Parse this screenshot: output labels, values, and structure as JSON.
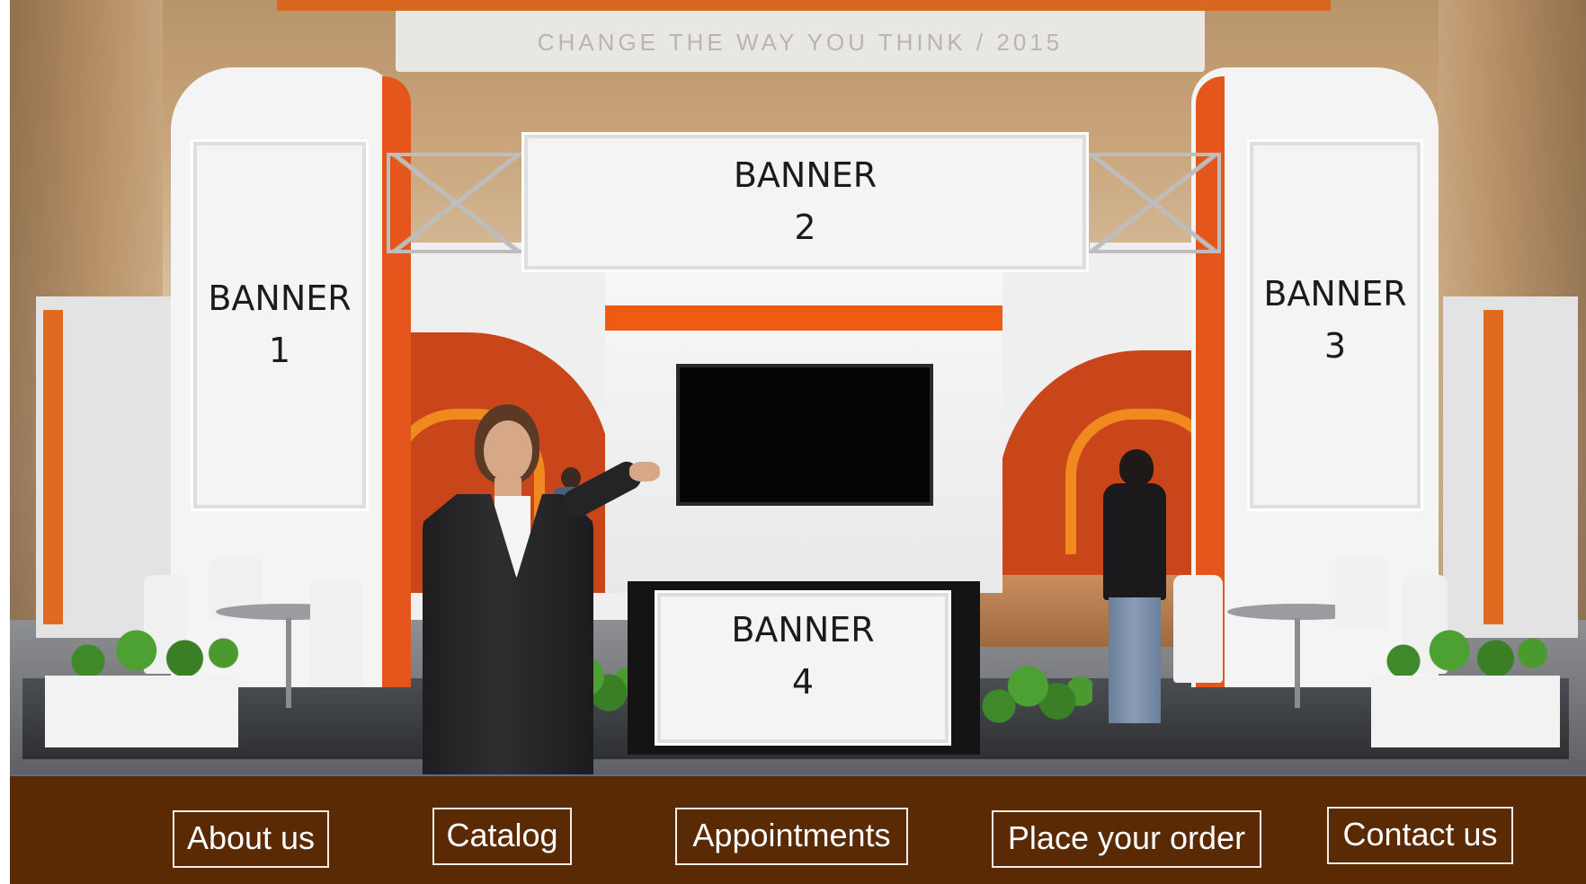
{
  "hall": {
    "sign_text": "CHANGE THE WAY YOU THINK / 2015"
  },
  "banners": [
    {
      "label": "BANNER\n1"
    },
    {
      "label": "BANNER\n2"
    },
    {
      "label": "BANNER\n3"
    },
    {
      "label": "BANNER\n4"
    }
  ],
  "nav": {
    "items": [
      {
        "label": "About us"
      },
      {
        "label": "Catalog"
      },
      {
        "label": "Appointments"
      },
      {
        "label": "Place your order"
      },
      {
        "label": "Contact us"
      }
    ]
  },
  "colors": {
    "nav_background": "#5a2a05",
    "accent_orange": "#e4561b",
    "nav_button_border": "#f2ede8"
  }
}
